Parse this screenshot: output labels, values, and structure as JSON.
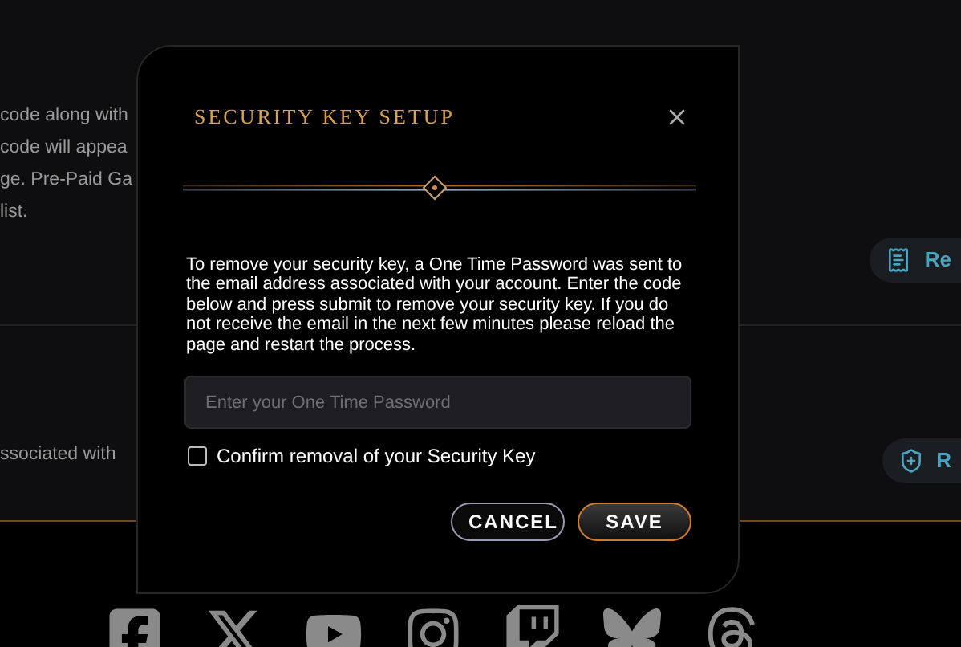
{
  "background": {
    "description_lines": [
      "code along with",
      "code will appea",
      "ge. Pre-Paid Ga",
      "list."
    ],
    "receipt_button": {
      "label": "Re"
    },
    "key_text": "ssociated with",
    "register_button": {
      "label": "R"
    }
  },
  "modal": {
    "title": "SECURITY KEY SETUP",
    "message": "To remove your security key, a One Time Password was sent to the email address associated with your account. Enter the code below and press submit to remove your security key. If you do not receive the email in the next few minutes please reload the page and restart the process.",
    "otp_field": {
      "placeholder": "Enter your One Time Password"
    },
    "confirm": {
      "label": "Confirm removal of your Security Key",
      "checked": false
    },
    "buttons": [
      {
        "kind": "secondary",
        "label": "CANCEL"
      },
      {
        "kind": "primary",
        "label": "SAVE"
      }
    ]
  }
}
